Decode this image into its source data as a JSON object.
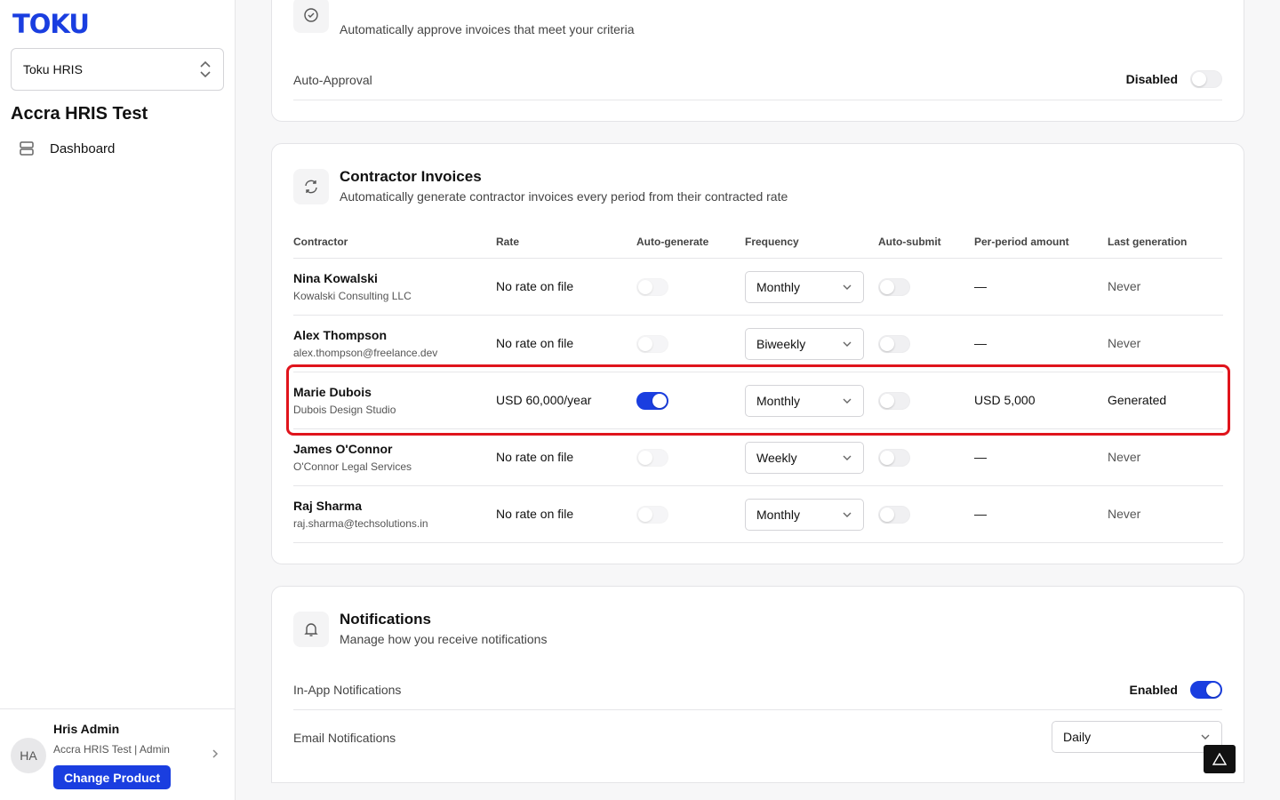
{
  "sidebar": {
    "logo": "TOKU",
    "product_select": "Toku HRIS",
    "org_name": "Accra HRIS Test",
    "nav": [
      {
        "label": "Dashboard",
        "icon": "dashboard-icon"
      }
    ],
    "user": {
      "initials": "HA",
      "name": "Hris Admin",
      "meta": "Accra HRIS Test | Admin",
      "change_product": "Change Product"
    }
  },
  "auto_approval": {
    "subtitle": "Automatically approve invoices that meet your criteria",
    "setting_label": "Auto-Approval",
    "status": "Disabled"
  },
  "contractor_invoices": {
    "title": "Contractor Invoices",
    "subtitle": "Automatically generate contractor invoices every period from their contracted rate",
    "columns": {
      "contractor": "Contractor",
      "rate": "Rate",
      "auto_generate": "Auto-generate",
      "frequency": "Frequency",
      "auto_submit": "Auto-submit",
      "amount": "Per-period amount",
      "last": "Last generation"
    },
    "rows": [
      {
        "name": "Nina Kowalski",
        "sub": "Kowalski Consulting LLC",
        "rate": "No rate on file",
        "auto_generate": false,
        "frequency": "Monthly",
        "auto_submit": false,
        "amount": "—",
        "last": "Never"
      },
      {
        "name": "Alex Thompson",
        "sub": "alex.thompson@freelance.dev",
        "rate": "No rate on file",
        "auto_generate": false,
        "frequency": "Biweekly",
        "auto_submit": false,
        "amount": "—",
        "last": "Never"
      },
      {
        "name": "Marie Dubois",
        "sub": "Dubois Design Studio",
        "rate": "USD 60,000/year",
        "auto_generate": true,
        "frequency": "Monthly",
        "auto_submit": false,
        "amount": "USD 5,000",
        "last": "Generated"
      },
      {
        "name": "James O'Connor",
        "sub": "O'Connor Legal Services",
        "rate": "No rate on file",
        "auto_generate": false,
        "frequency": "Weekly",
        "auto_submit": false,
        "amount": "—",
        "last": "Never"
      },
      {
        "name": "Raj Sharma",
        "sub": "raj.sharma@techsolutions.in",
        "rate": "No rate on file",
        "auto_generate": false,
        "frequency": "Monthly",
        "auto_submit": false,
        "amount": "—",
        "last": "Never"
      }
    ]
  },
  "notifications": {
    "title": "Notifications",
    "subtitle": "Manage how you receive notifications",
    "in_app_label": "In-App Notifications",
    "in_app_status": "Enabled",
    "email_label": "Email Notifications",
    "email_value": "Daily"
  },
  "colors": {
    "accent": "#1a3ee0",
    "highlight": "#e0141c"
  }
}
